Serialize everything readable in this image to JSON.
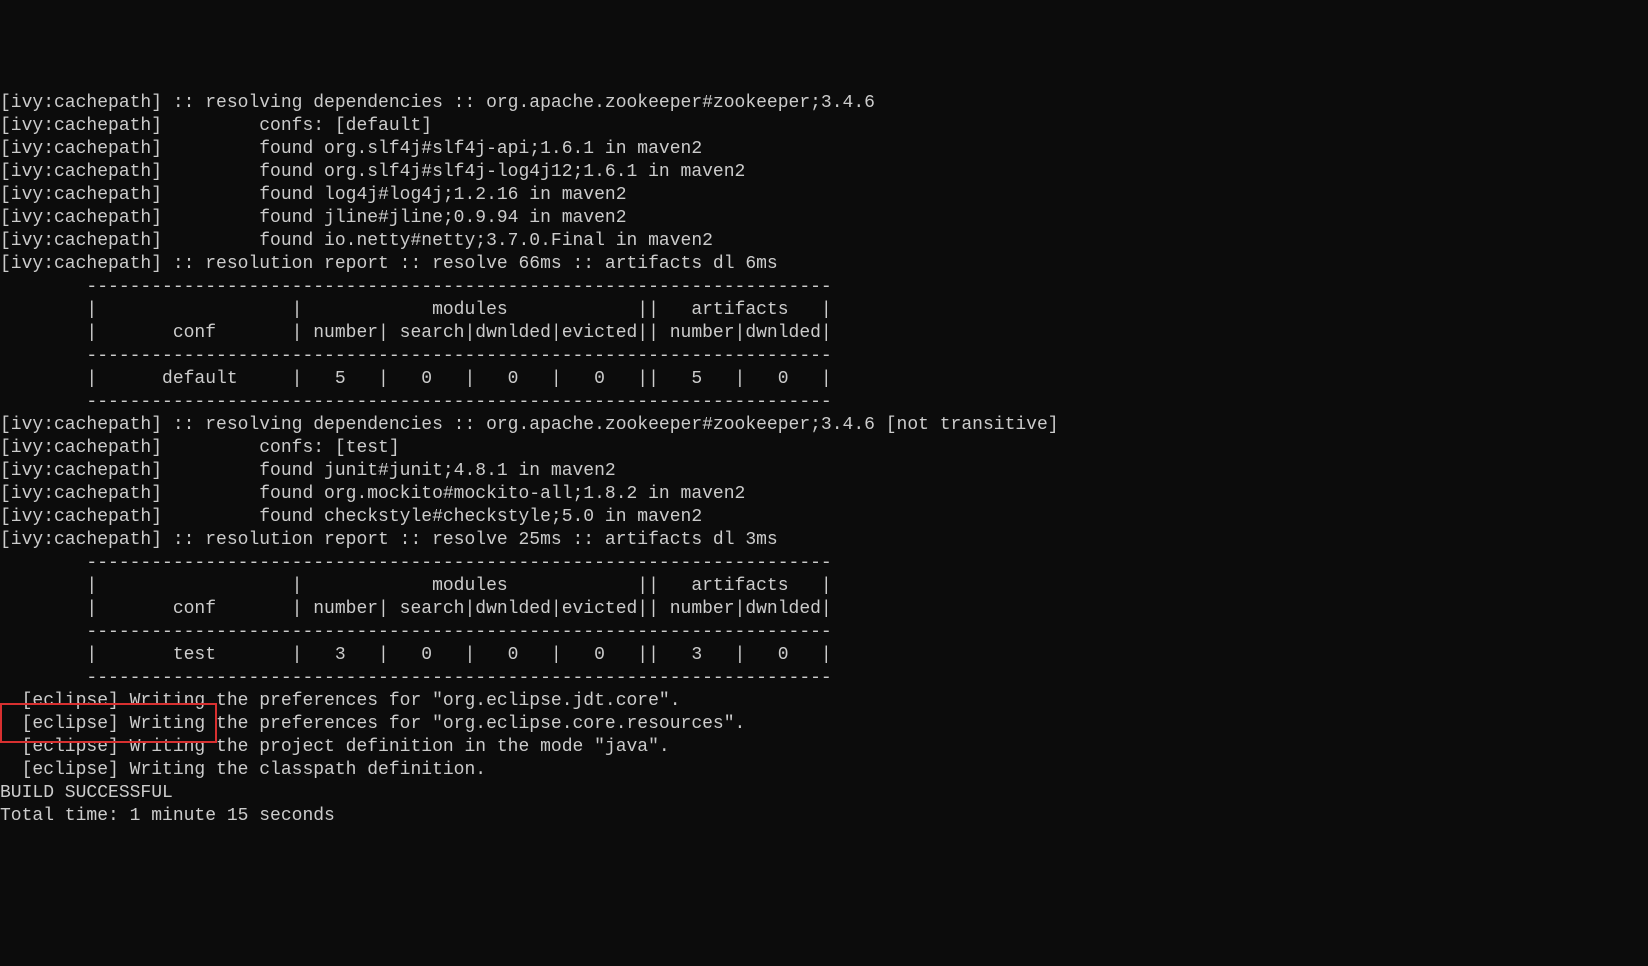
{
  "terminal": {
    "lines": [
      "[ivy:cachepath] :: resolving dependencies :: org.apache.zookeeper#zookeeper;3.4.6",
      "[ivy:cachepath]         confs: [default]",
      "[ivy:cachepath]         found org.slf4j#slf4j-api;1.6.1 in maven2",
      "[ivy:cachepath]         found org.slf4j#slf4j-log4j12;1.6.1 in maven2",
      "[ivy:cachepath]         found log4j#log4j;1.2.16 in maven2",
      "[ivy:cachepath]         found jline#jline;0.9.94 in maven2",
      "[ivy:cachepath]         found io.netty#netty;3.7.0.Final in maven2",
      "[ivy:cachepath] :: resolution report :: resolve 66ms :: artifacts dl 6ms",
      "        ---------------------------------------------------------------------",
      "        |                  |            modules            ||   artifacts   |",
      "        |       conf       | number| search|dwnlded|evicted|| number|dwnlded|",
      "        ---------------------------------------------------------------------",
      "        |      default     |   5   |   0   |   0   |   0   ||   5   |   0   |",
      "        ---------------------------------------------------------------------",
      "[ivy:cachepath] :: resolving dependencies :: org.apache.zookeeper#zookeeper;3.4.6 [not transitive]",
      "[ivy:cachepath]         confs: [test]",
      "[ivy:cachepath]         found junit#junit;4.8.1 in maven2",
      "[ivy:cachepath]         found org.mockito#mockito-all;1.8.2 in maven2",
      "[ivy:cachepath]         found checkstyle#checkstyle;5.0 in maven2",
      "[ivy:cachepath] :: resolution report :: resolve 25ms :: artifacts dl 3ms",
      "        ---------------------------------------------------------------------",
      "        |                  |            modules            ||   artifacts   |",
      "        |       conf       | number| search|dwnlded|evicted|| number|dwnlded|",
      "        ---------------------------------------------------------------------",
      "        |       test       |   3   |   0   |   0   |   0   ||   3   |   0   |",
      "        ---------------------------------------------------------------------",
      "  [eclipse] Writing the preferences for \"org.eclipse.jdt.core\".",
      "  [eclipse] Writing the preferences for \"org.eclipse.core.resources\".",
      "  [eclipse] Writing the project definition in the mode \"java\".",
      "  [eclipse] Writing the classpath definition.",
      "",
      "BUILD SUCCESSFUL",
      "Total time: 1 minute 15 seconds",
      ""
    ]
  }
}
